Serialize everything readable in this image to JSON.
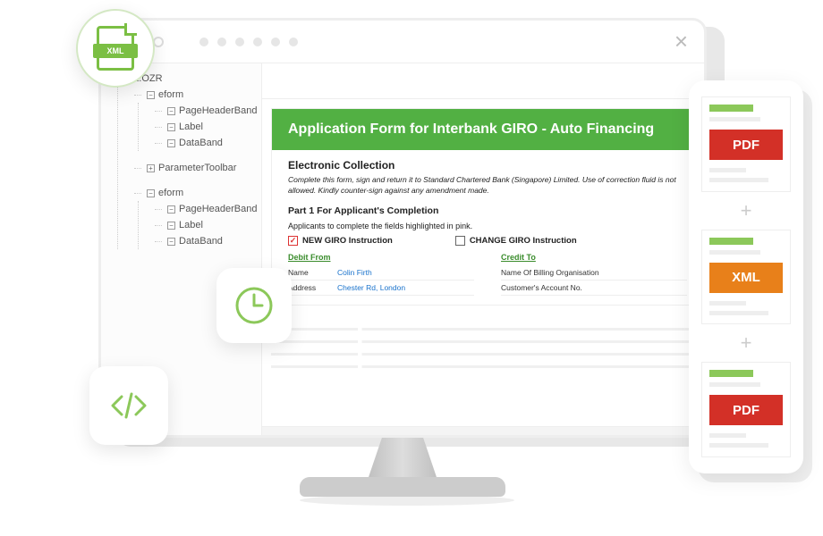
{
  "colors": {
    "accent": "#52b043",
    "pdf": "#d33027",
    "xml": "#e8801a"
  },
  "icons": {
    "xml_badge": "XML",
    "pdf_label": "PDF",
    "xml_label": "XML"
  },
  "titlebar": {
    "close": "×"
  },
  "sidebar": {
    "root": "OZ.OZR",
    "groups": [
      {
        "label": "eform",
        "children": [
          "PageHeaderBand",
          "Label",
          "DataBand"
        ]
      },
      {
        "label": "ParameterToolbar",
        "children": []
      },
      {
        "label": "eform",
        "children": [
          "PageHeaderBand",
          "Label",
          "DataBand"
        ]
      }
    ]
  },
  "form": {
    "title": "Application Form for Interbank GIRO - Auto Financing",
    "section": "Electronic Collection",
    "instruction": "Complete this form, sign and return it to Standard Chartered Bank (Singapore) Limited. Use of correction fluid is not allowed. Kindly counter-sign against any amendment made.",
    "part": "Part 1 For Applicant's Completion",
    "sub": "Applicants to complete the fields highlighted in pink.",
    "checks": {
      "new": "NEW GIRO Instruction",
      "change": "CHANGE GIRO Instruction"
    },
    "debit": {
      "heading": "Debit From",
      "name_label": "Name",
      "name_value": "Colin Firth",
      "address_label": "Address",
      "address_value": "Chester Rd, London"
    },
    "credit": {
      "heading": "Credit To",
      "org_label": "Name Of Billing Organisation",
      "acct_label": "Customer's Account No."
    }
  },
  "export": {
    "items": [
      "PDF",
      "XML",
      "PDF"
    ]
  }
}
